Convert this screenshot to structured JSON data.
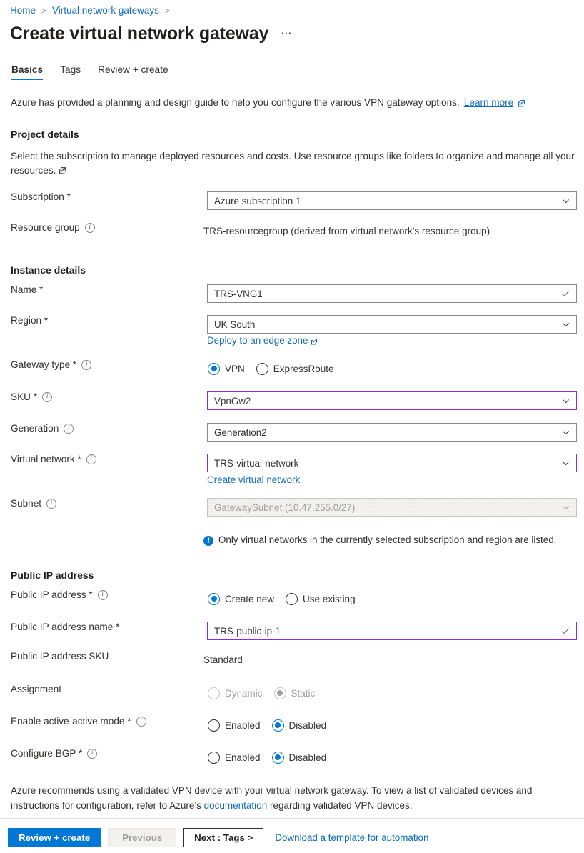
{
  "breadcrumb": {
    "items": [
      {
        "label": "Home"
      },
      {
        "label": "Virtual network gateways"
      }
    ],
    "separator": ">"
  },
  "header": {
    "title": "Create virtual network gateway",
    "more_label": "⋯"
  },
  "tabs": [
    {
      "label": "Basics",
      "active": true
    },
    {
      "label": "Tags",
      "active": false
    },
    {
      "label": "Review + create",
      "active": false
    }
  ],
  "intro": {
    "text": "Azure has provided a planning and design guide to help you configure the various VPN gateway options.",
    "link_label": "Learn more"
  },
  "project_details": {
    "heading": "Project details",
    "description": "Select the subscription to manage deployed resources and costs. Use resource groups like folders to organize and manage all your resources.",
    "subscription": {
      "label": "Subscription *",
      "value": "Azure subscription 1"
    },
    "resource_group": {
      "label": "Resource group",
      "value": "TRS-resourcegroup (derived from virtual network’s resource group)"
    }
  },
  "instance_details": {
    "heading": "Instance details",
    "name": {
      "label": "Name *",
      "value": "TRS-VNG1"
    },
    "region": {
      "label": "Region *",
      "value": "UK South",
      "sublink": "Deploy to an edge zone"
    },
    "gateway_type": {
      "label": "Gateway type *",
      "options": [
        {
          "label": "VPN",
          "checked": true
        },
        {
          "label": "ExpressRoute",
          "checked": false
        }
      ]
    },
    "sku": {
      "label": "SKU *",
      "value": "VpnGw2"
    },
    "generation": {
      "label": "Generation",
      "value": "Generation2"
    },
    "virtual_network": {
      "label": "Virtual network *",
      "value": "TRS-virtual-network",
      "sublink": "Create virtual network"
    },
    "subnet": {
      "label": "Subnet",
      "value": "GatewaySubnet (10.47.255.0/27)",
      "disabled": true
    },
    "note": "Only virtual networks in the currently selected subscription and region are listed."
  },
  "public_ip": {
    "heading": "Public IP address",
    "public_ip_address": {
      "label": "Public IP address *",
      "options": [
        {
          "label": "Create new",
          "checked": true
        },
        {
          "label": "Use existing",
          "checked": false
        }
      ]
    },
    "public_ip_name": {
      "label": "Public IP address name *",
      "value": "TRS-public-ip-1"
    },
    "public_ip_sku": {
      "label": "Public IP address SKU",
      "value": "Standard"
    },
    "assignment": {
      "label": "Assignment",
      "disabled": true,
      "options": [
        {
          "label": "Dynamic",
          "checked": false
        },
        {
          "label": "Static",
          "checked": true
        }
      ]
    },
    "active_active": {
      "label": "Enable active-active mode *",
      "options": [
        {
          "label": "Enabled",
          "checked": false
        },
        {
          "label": "Disabled",
          "checked": true
        }
      ]
    },
    "configure_bgp": {
      "label": "Configure BGP *",
      "options": [
        {
          "label": "Enabled",
          "checked": false
        },
        {
          "label": "Disabled",
          "checked": true
        }
      ]
    }
  },
  "footer": {
    "note_part1": "Azure recommends using a validated VPN device with your virtual network gateway. To view a list of validated devices and instructions for configuration, refer to Azure’s ",
    "note_link": "documentation",
    "note_part2": " regarding validated VPN devices.",
    "review_create": "Review + create",
    "previous": "Previous",
    "next": "Next : Tags >",
    "download_template": "Download a template for automation"
  },
  "colors": {
    "accent_blue": "#0078d4",
    "link_blue": "#0f6cbd",
    "modified_purple": "#8a2be2",
    "disabled_gray": "#a19f9d"
  }
}
